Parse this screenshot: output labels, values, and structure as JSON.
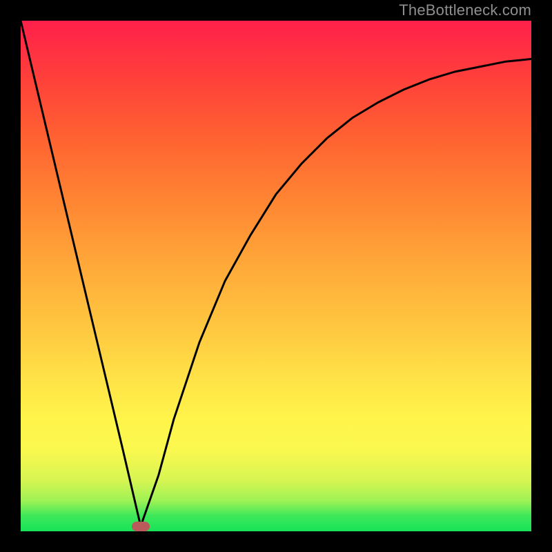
{
  "watermark": "TheBottleneck.com",
  "chart_data": {
    "type": "line",
    "title": "",
    "xlabel": "",
    "ylabel": "",
    "xlim": [
      0,
      1
    ],
    "ylim": [
      0,
      1
    ],
    "series": [
      {
        "name": "curve",
        "x": [
          0.0,
          0.05,
          0.1,
          0.15,
          0.2,
          0.235,
          0.27,
          0.3,
          0.35,
          0.4,
          0.45,
          0.5,
          0.55,
          0.6,
          0.65,
          0.7,
          0.75,
          0.8,
          0.85,
          0.9,
          0.95,
          1.0
        ],
        "values": [
          1.0,
          0.79,
          0.58,
          0.37,
          0.16,
          0.01,
          0.11,
          0.22,
          0.37,
          0.49,
          0.58,
          0.66,
          0.72,
          0.77,
          0.81,
          0.84,
          0.865,
          0.885,
          0.9,
          0.91,
          0.92,
          0.925
        ]
      }
    ],
    "background_gradient": {
      "top": "#ff204a",
      "bottom": "#18e258"
    },
    "marker": {
      "x": 0.235,
      "y": 0.01,
      "color": "#bb5a5a"
    }
  }
}
